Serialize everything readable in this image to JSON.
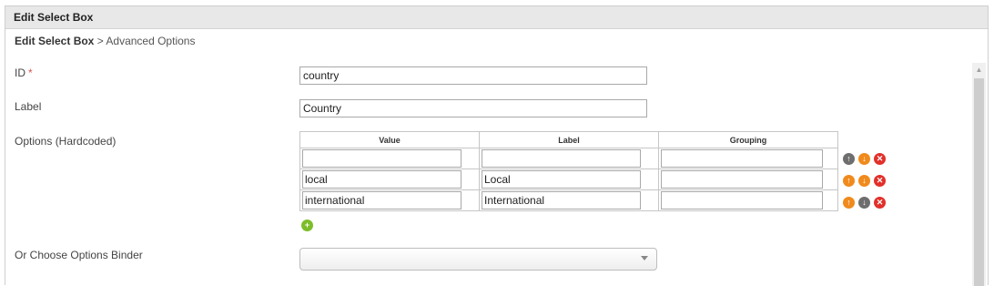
{
  "title": "Edit Select Box",
  "breadcrumb": {
    "current": "Edit Select Box",
    "separator": ">",
    "page": "Advanced Options"
  },
  "form": {
    "id": {
      "label": "ID",
      "required_mark": "*",
      "value": "country"
    },
    "label": {
      "label": "Label",
      "value": "Country"
    },
    "options": {
      "label": "Options (Hardcoded)",
      "columns": [
        "Value",
        "Label",
        "Grouping"
      ],
      "rows": [
        {
          "value": "",
          "label": "",
          "grouping": ""
        },
        {
          "value": "local",
          "label": "Local",
          "grouping": ""
        },
        {
          "value": "international",
          "label": "International",
          "grouping": ""
        }
      ],
      "row_icons": [
        [
          "arrow-up-icon",
          "arrow-down-icon",
          "delete-icon"
        ],
        [
          "arrow-up-icon",
          "arrow-down-icon",
          "delete-icon"
        ],
        [
          "arrow-up-icon",
          "arrow-down-icon",
          "delete-icon"
        ]
      ]
    },
    "binder": {
      "label": "Or Choose Options Binder",
      "selected": ""
    }
  },
  "colors": {
    "orange": "#f08a1c",
    "gray": "#6e6e6e",
    "red": "#e2302a",
    "green": "#7dbd2a"
  }
}
